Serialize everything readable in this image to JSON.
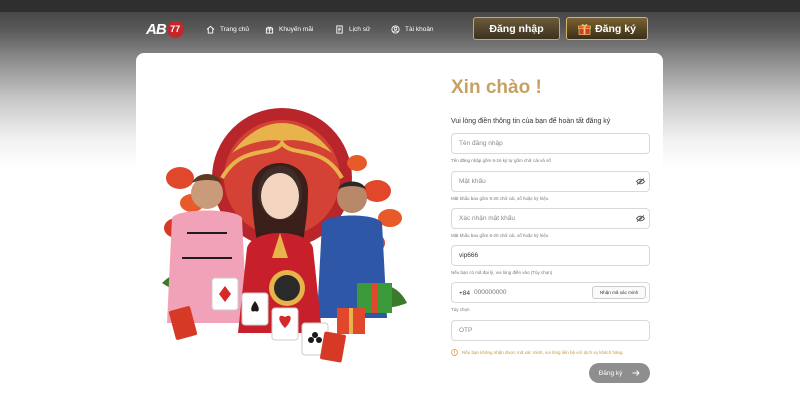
{
  "header": {
    "logo": {
      "text": "AB",
      "number": "77"
    },
    "nav": [
      {
        "label": "Trang chủ",
        "icon": "home-icon"
      },
      {
        "label": "Khuyến mãi",
        "icon": "gift-icon"
      },
      {
        "label": "Lịch sử",
        "icon": "history-icon"
      },
      {
        "label": "Tài khoản",
        "icon": "user-icon"
      }
    ],
    "login_label": "Đăng nhập",
    "register_label": "Đăng ký"
  },
  "form": {
    "title": "Xin chào !",
    "subtitle": "Vui lòng điền thông tin của bạn để hoàn tất đăng ký",
    "username": {
      "placeholder": "Tên đăng nhập",
      "hint": "Tên đăng nhập gồm 6-16 ký tự gồm chữ cái và số"
    },
    "password": {
      "placeholder": "Mật khẩu",
      "hint": "Mật khẩu bao gồm 8-20 chữ cái, số hoặc ký hiệu"
    },
    "confirm_password": {
      "placeholder": "Xác nhận mật khẩu",
      "hint": "Mật khẩu bao gồm 8-20 chữ cái, số hoặc ký hiệu"
    },
    "referral": {
      "value": "vip666",
      "hint": "Nếu bạn có mã đại lý, vui lòng điền vào (Tùy chọn)"
    },
    "phone": {
      "prefix": "+84",
      "placeholder": "000000000",
      "verify_label": "Nhận mã xác minh",
      "hint": "Tùy chọn"
    },
    "otp": {
      "placeholder": "OTP"
    },
    "notice": "Nếu bạn không nhận được mã xác minh, vui lòng liên hệ với dịch vụ khách hàng",
    "submit_label": "Đăng ký"
  },
  "colors": {
    "accent_gold": "#c7a162",
    "notice": "#c9973e",
    "submit_bg": "#8e8e8e",
    "logo_red": "#c6262a"
  }
}
